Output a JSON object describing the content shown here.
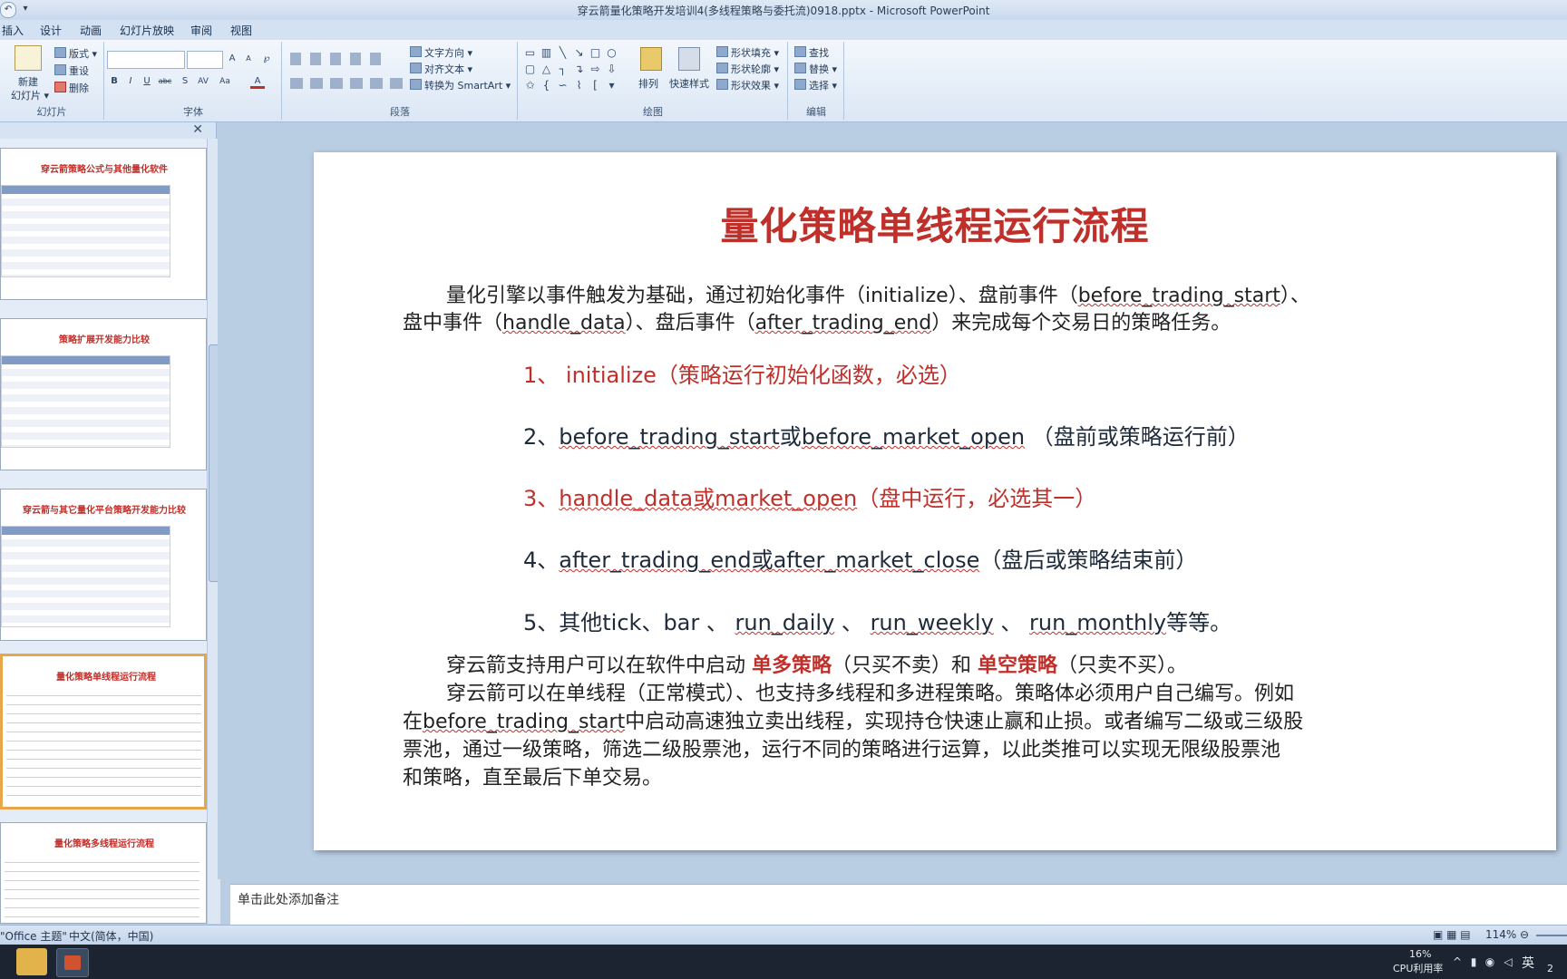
{
  "window": {
    "title": "穿云箭量化策略开发培训4(多线程策略与委托流)0918.pptx - Microsoft PowerPoint"
  },
  "qat": {
    "undo": "↶",
    "more": "▾"
  },
  "tabs": [
    "插入",
    "设计",
    "动画",
    "幻灯片放映",
    "审阅",
    "视图"
  ],
  "ribbon": {
    "slides": {
      "label": "幻灯片",
      "new_slide": "新建",
      "new_slide2": "幻灯片 ▾",
      "layout": "版式 ▾",
      "reset": "重设",
      "delete": "删除"
    },
    "font": {
      "label": "字体",
      "grow": "A",
      "shrink": "A",
      "clear": "℘",
      "bold": "B",
      "italic": "I",
      "underline": "U",
      "strike": "abc",
      "shadow": "S",
      "spacing": "AV",
      "case": "Aa",
      "color": "A"
    },
    "paragraph": {
      "label": "段落",
      "text_direction": "文字方向 ▾",
      "align_text": "对齐文本 ▾",
      "smartart": "转换为 SmartArt ▾"
    },
    "drawing": {
      "label": "绘图",
      "arrange": "排列",
      "quick_styles": "快速样式",
      "shape_fill": "形状填充 ▾",
      "shape_outline": "形状轮廓 ▾",
      "shape_effects": "形状效果 ▾"
    },
    "editing": {
      "label": "编辑",
      "find": "查找",
      "replace": "替换 ▾",
      "select": "选择 ▾"
    }
  },
  "panel": {
    "close": "✕"
  },
  "thumbnails": [
    {
      "title": "穿云箭策略公式与其他量化软件"
    },
    {
      "title": "策略扩展开发能力比较"
    },
    {
      "title": "穿云箭与其它量化平台策略开发能力比较"
    },
    {
      "title": "量化策略单线程运行流程"
    },
    {
      "title": "量化策略多线程运行流程"
    }
  ],
  "slide": {
    "title": "量化策略单线程运行流程",
    "intro": {
      "l1_a": "量化引擎以事件触发为基础，通过初始化事件（initialize）、盘前事件（",
      "l1_u": "before_trading_start",
      "l1_b": "）、",
      "l2_a": "盘中事件（",
      "l2_u1": "handle_data",
      "l2_b": "）、盘后事件（",
      "l2_u2": "after_trading_end",
      "l2_c": "）来完成每个交易日的策略任务。"
    },
    "item1": "1、 initialize（策略运行初始化函数，必选）",
    "item2": {
      "a": "2、",
      "u1": "before_trading_start",
      "b": "或",
      "u2": "before_market_open",
      "c": " （盘前或策略运行前）"
    },
    "item3": {
      "a": "3、",
      "u1": "handle_data或market_open",
      "c": "（盘中运行，必选其一）"
    },
    "item4": {
      "a": "4、",
      "u1": "after_trading_end或after_market_close",
      "c": "（盘后或策略结束前）"
    },
    "item5": {
      "a": "5、其他tick、bar 、 ",
      "u1": "run_daily",
      "b": " 、 ",
      "u2": "run_weekly",
      "c": " 、 ",
      "u3": "run_monthly",
      "d": "等等。"
    },
    "p2": {
      "a": "穿云箭支持用户可以在软件中启动 ",
      "b1": "单多策略",
      "b": "（只买不卖）和 ",
      "b2": "单空策略",
      "c": "（只卖不买）。"
    },
    "p3": {
      "l1": "穿云箭可以在单线程（正常模式）、也支持多线程和多进程策略。策略体必须用户自己编写。例如",
      "l2_a": "在",
      "l2_u": "before_trading_start",
      "l2_b": "中启动高速独立卖出线程，实现持仓快速止赢和止损。或者编写二级或三级股",
      "l3": "票池，通过一级策略，筛选二级股票池，运行不同的策略进行运算，以此类推可以实现无限级股票池",
      "l4": "和策略，直至最后下单交易。"
    }
  },
  "notes": {
    "placeholder": "单击此处添加备注"
  },
  "status": {
    "theme": "\"Office 主题\"",
    "language": "中文(简体，中国)",
    "zoom": "114%"
  },
  "taskbar": {
    "cpu_pct": "16%",
    "cpu_label": "CPU利用率",
    "ime": "英",
    "time": "2"
  },
  "colors": {
    "title_red": "#c0302b",
    "ribbon": "#dbe7f5",
    "canvas": "#b9cde3"
  }
}
